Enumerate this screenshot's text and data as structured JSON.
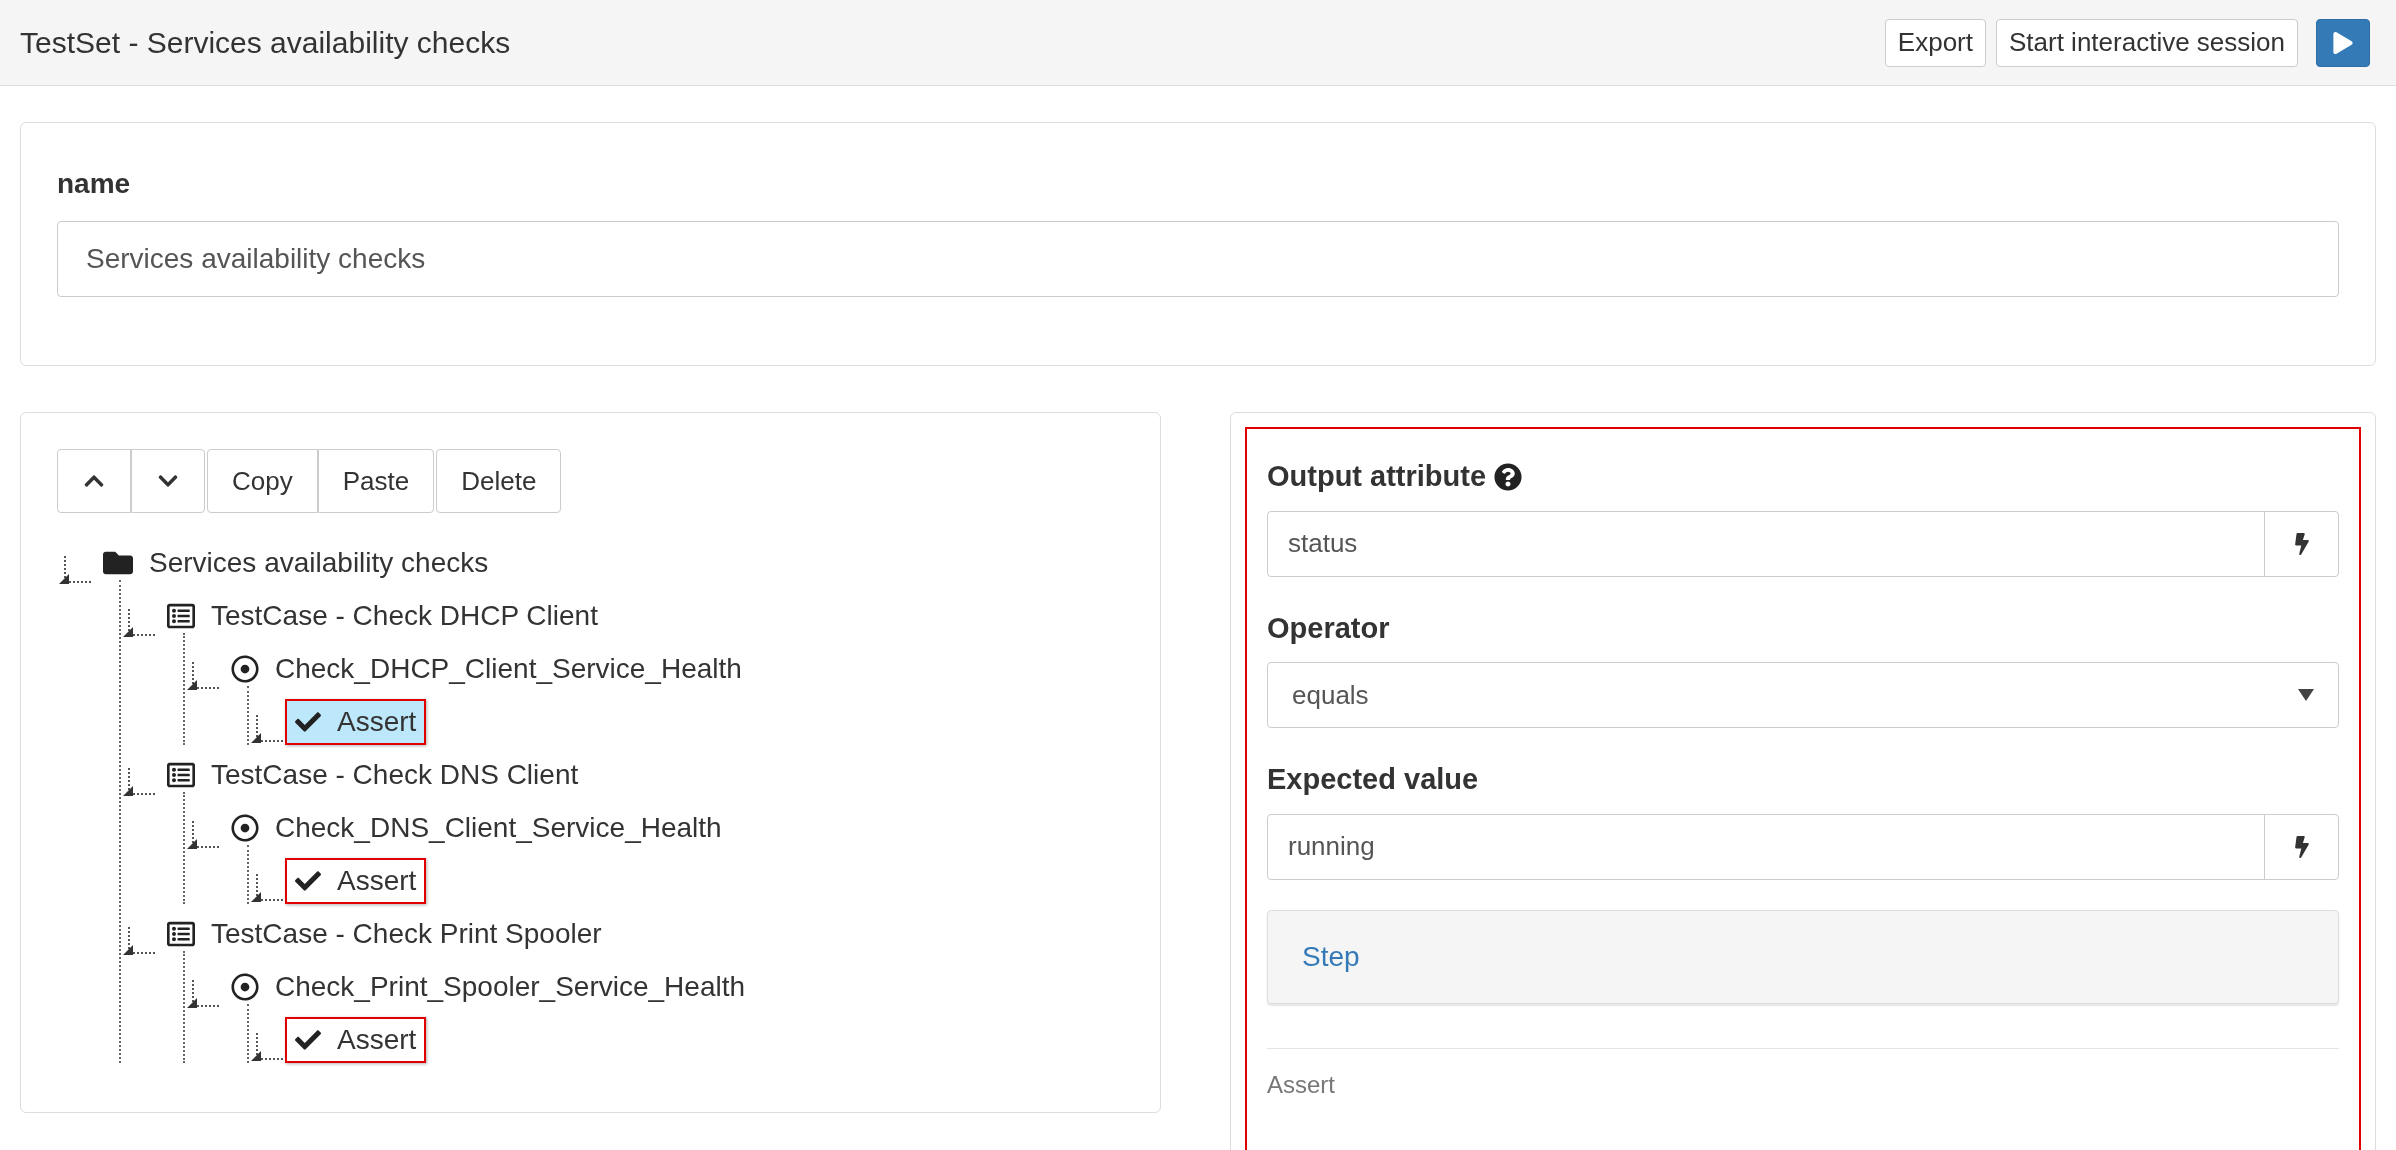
{
  "header": {
    "title": "TestSet - Services availability checks",
    "buttons": [
      {
        "kind": "text",
        "label": "Export"
      },
      {
        "kind": "text",
        "label": "Start interactive session"
      },
      {
        "kind": "play"
      }
    ]
  },
  "name_card": {
    "label": "name",
    "value": "Services availability checks"
  },
  "toolbar_groups": [
    {
      "buttons": [
        {
          "kind": "up"
        },
        {
          "kind": "down"
        }
      ]
    },
    {
      "buttons": [
        {
          "kind": "text",
          "label": "Copy"
        },
        {
          "kind": "text",
          "label": "Paste"
        }
      ]
    },
    {
      "buttons": [
        {
          "kind": "text",
          "label": "Delete"
        }
      ]
    }
  ],
  "tree": [
    {
      "kind": "folder",
      "label": "Services availability checks",
      "selected": false,
      "flagged": false,
      "children": [
        {
          "kind": "testcase",
          "label": "TestCase - Check DHCP Client",
          "selected": false,
          "flagged": false,
          "children": [
            {
              "kind": "step",
              "label": "Check_DHCP_Client_Service_Health",
              "selected": false,
              "flagged": false,
              "children": [
                {
                  "kind": "assert",
                  "label": "Assert",
                  "selected": true,
                  "flagged": true
                }
              ]
            }
          ]
        },
        {
          "kind": "testcase",
          "label": "TestCase - Check DNS Client",
          "selected": false,
          "flagged": false,
          "children": [
            {
              "kind": "step",
              "label": "Check_DNS_Client_Service_Health",
              "selected": false,
              "flagged": false,
              "children": [
                {
                  "kind": "assert",
                  "label": "Assert",
                  "selected": false,
                  "flagged": true
                }
              ]
            }
          ]
        },
        {
          "kind": "testcase",
          "label": "TestCase - Check Print Spooler",
          "selected": false,
          "flagged": false,
          "children": [
            {
              "kind": "step",
              "label": "Check_Print_Spooler_Service_Health",
              "selected": false,
              "flagged": false,
              "children": [
                {
                  "kind": "assert",
                  "label": "Assert",
                  "selected": false,
                  "flagged": true
                }
              ]
            }
          ]
        }
      ]
    }
  ],
  "editor": {
    "flagged": true,
    "fields": [
      {
        "kind": "input",
        "label": "Output attribute",
        "help": true,
        "value": "status"
      },
      {
        "kind": "select",
        "label": "Operator",
        "help": false,
        "value": "equals"
      },
      {
        "kind": "input",
        "label": "Expected value",
        "help": false,
        "value": "running"
      }
    ],
    "step_link": "Step",
    "footer": "Assert"
  }
}
